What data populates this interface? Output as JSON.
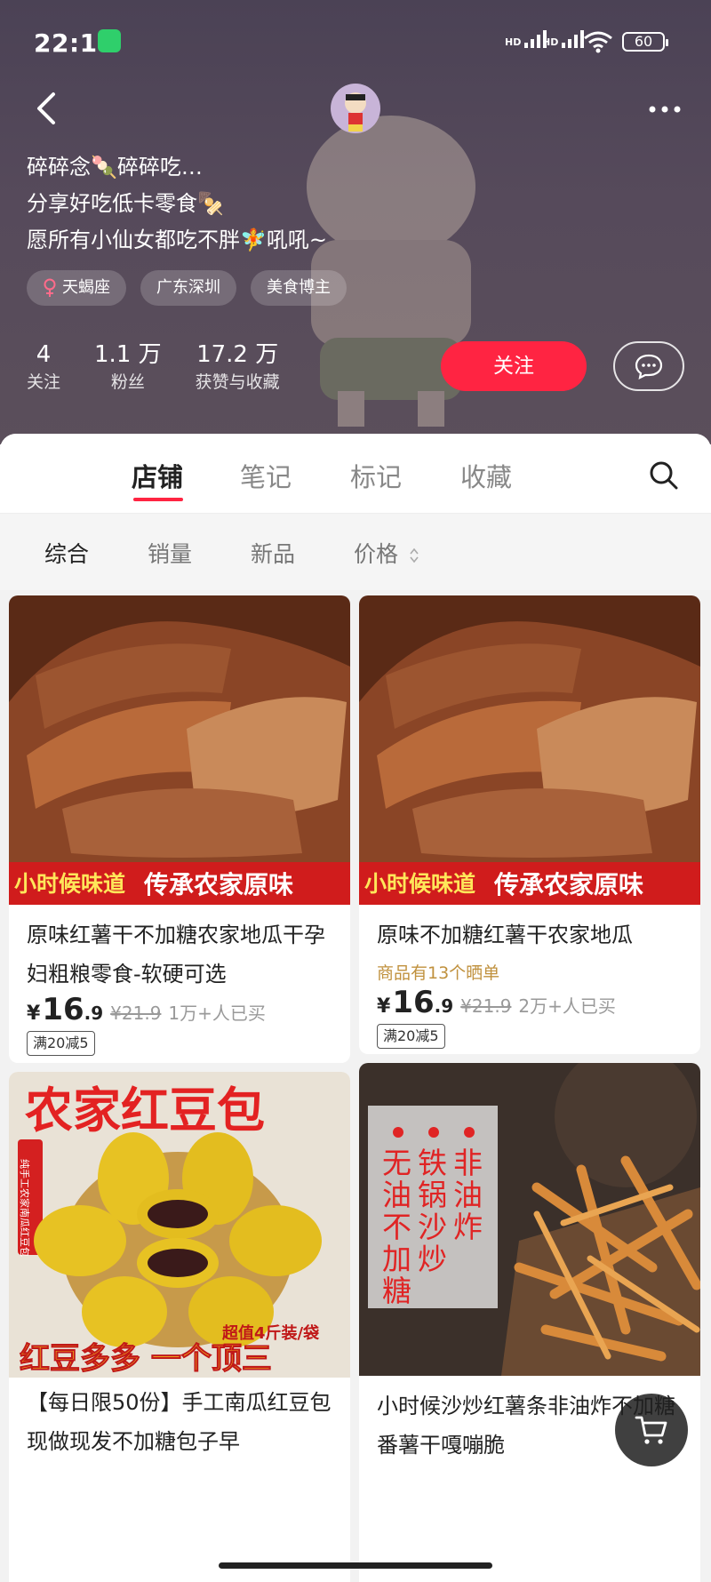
{
  "status": {
    "time": "22:16",
    "net1": "HD",
    "net2": "HD",
    "battery": "60"
  },
  "profile": {
    "bio": [
      "碎碎念🍡碎碎吃…",
      "分享好吃低卡零食🍢",
      "愿所有小仙女都吃不胖🧚吼吼~"
    ],
    "tags": [
      {
        "icon": "female-icon",
        "label": "天蝎座"
      },
      {
        "label": "广东深圳"
      },
      {
        "label": "美食博主"
      }
    ],
    "stats": [
      {
        "num": "4",
        "label": "关注"
      },
      {
        "num": "1.1 万",
        "label": "粉丝"
      },
      {
        "num": "17.2 万",
        "label": "获赞与收藏"
      }
    ],
    "follow_label": "关注"
  },
  "tabs": [
    "店铺",
    "笔记",
    "标记",
    "收藏"
  ],
  "filters": [
    "综合",
    "销量",
    "新品",
    "价格"
  ],
  "products": [
    {
      "banner_left": "小时候味道",
      "banner_right": "传承农家原味",
      "title": "原味红薯干不加糖农家地瓜干孕妇粗粮零食-软硬可选",
      "price_symbol": "¥",
      "price_int": "16",
      "price_dec": ".9",
      "price_old": "¥21.9",
      "sold": "1万+人已买",
      "coupon": "满20减5"
    },
    {
      "banner_left": "小时候味道",
      "banner_right": "传承农家原味",
      "title": "原味不加糖红薯干农家地瓜",
      "reviews": "商品有13个晒单",
      "price_symbol": "¥",
      "price_int": "16",
      "price_dec": ".9",
      "price_old": "¥21.9",
      "sold": "2万+人已买",
      "coupon": "满20减5"
    },
    {
      "headline": "农家红豆包",
      "side_label": "纯手工农家南瓜红豆包",
      "promo": "超值4斤装/袋",
      "slogan": "红豆多多 一个顶三",
      "title": "【每日限50份】手工南瓜红豆包现做现发不加糖包子早"
    },
    {
      "side_text": [
        "无",
        "油",
        "不",
        "加",
        "糖"
      ],
      "side_text2": [
        "铁",
        "锅",
        "沙",
        "炒"
      ],
      "side_text3": [
        "非",
        "油",
        "炸"
      ],
      "title": "小时候沙炒红薯条非油炸不加糖番薯干嘎嘣脆"
    }
  ],
  "colors": {
    "accent": "#ff2442",
    "header_bg": "#4b4255",
    "banner_red": "#d01c1c"
  }
}
